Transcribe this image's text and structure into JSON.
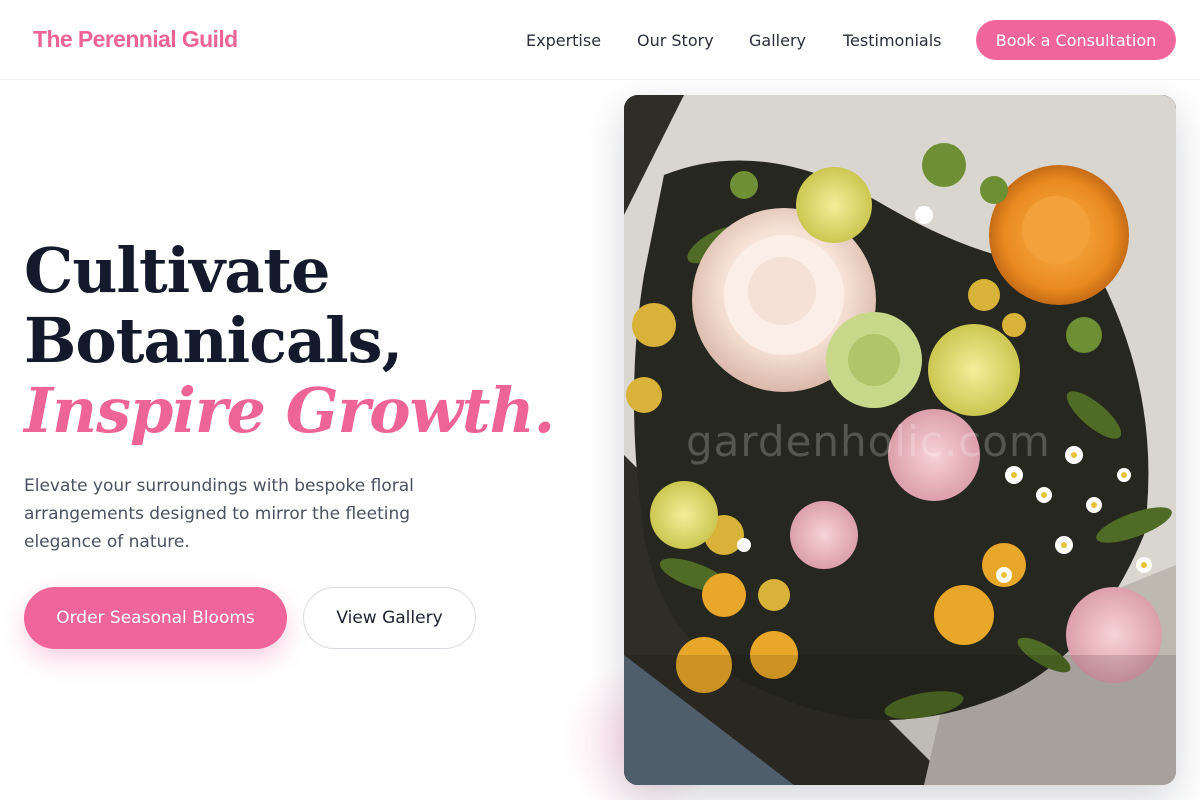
{
  "brand": {
    "name": "The Perennial Guild",
    "accent_color": "#f0659a",
    "text_color": "#141a2b"
  },
  "nav": {
    "links": [
      "Expertise",
      "Our Story",
      "Gallery",
      "Testimonials"
    ],
    "cta_label": "Book a Consultation"
  },
  "hero": {
    "headline_line1": "Cultivate",
    "headline_line2": "Botanicals,",
    "headline_accent": "Inspire Growth.",
    "subtext": "Elevate your surroundings with bespoke floral arrangements designed to mirror the fleeting elegance of nature.",
    "primary_button": "Order Seasonal Blooms",
    "secondary_button": "View Gallery"
  },
  "image": {
    "subject": "flower-bouquet-photo",
    "watermark": "gardenholic.com"
  }
}
